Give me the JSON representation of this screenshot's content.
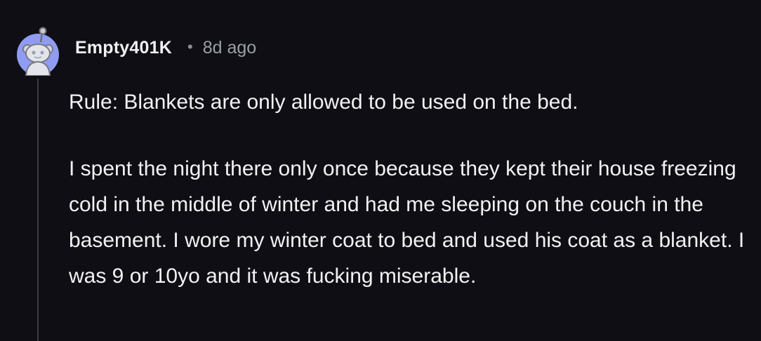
{
  "comment": {
    "username": "Empty401K",
    "separator": "•",
    "timestamp": "8d ago",
    "avatar_icon": "snoo-avatar-icon",
    "paragraphs": [
      "Rule: Blankets are only allowed to be used on the bed.",
      "I spent the night there only once because they kept their house freezing cold in the middle of winter and had me sleeping on the couch in the basement. I wore my winter coat to bed and used his coat as a blanket. I was 9 or 10yo and it was fucking miserable."
    ]
  },
  "colors": {
    "background": "#0e0e14",
    "text": "#f2f2f4",
    "muted": "#9aa0a6",
    "avatar_bg": "#8f9cf2",
    "thread_line": "#3a3d42"
  }
}
